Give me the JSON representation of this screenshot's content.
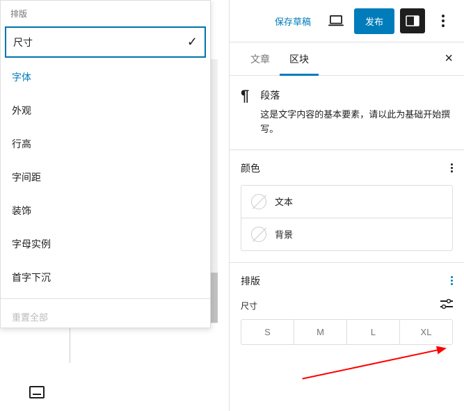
{
  "left_panel": {
    "header": "排版",
    "items": [
      {
        "label": "尺寸",
        "selected": true,
        "check": true
      },
      {
        "label": "字体",
        "blue": true
      },
      {
        "label": "外观"
      },
      {
        "label": "行高"
      },
      {
        "label": "字间距"
      },
      {
        "label": "装饰"
      },
      {
        "label": "字母实例"
      },
      {
        "label": "首字下沉"
      }
    ],
    "reset": "重置全部"
  },
  "topbar": {
    "save_draft": "保存草稿",
    "publish": "发布"
  },
  "tabs": {
    "post": "文章",
    "block": "区块"
  },
  "block_info": {
    "title": "段落",
    "desc": "这是文字内容的基本要素，请以此为基础开始撰写。"
  },
  "color_section": {
    "title": "颜色",
    "items": [
      "文本",
      "背景"
    ]
  },
  "typo_section": {
    "title": "排版",
    "size_label": "尺寸",
    "sizes": [
      "S",
      "M",
      "L",
      "XL"
    ]
  }
}
